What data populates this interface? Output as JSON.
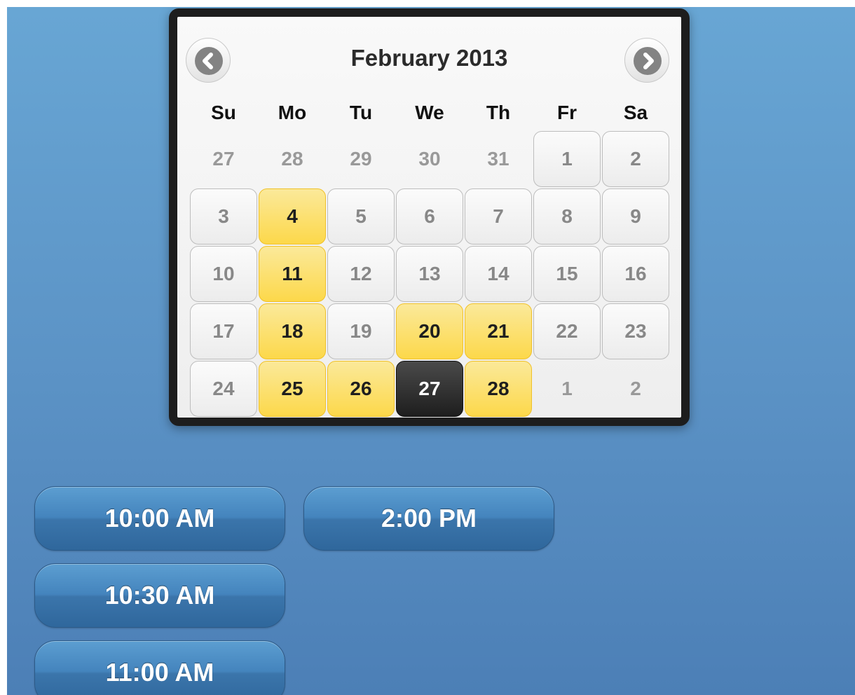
{
  "calendar": {
    "title": "February 2013",
    "prev_icon": "chevron-left-icon",
    "next_icon": "chevron-right-icon",
    "weekdays": [
      "Su",
      "Mo",
      "Tu",
      "We",
      "Th",
      "Fr",
      "Sa"
    ],
    "days": [
      {
        "label": "27",
        "kind": "other"
      },
      {
        "label": "28",
        "kind": "other"
      },
      {
        "label": "29",
        "kind": "other"
      },
      {
        "label": "30",
        "kind": "other"
      },
      {
        "label": "31",
        "kind": "other"
      },
      {
        "label": "1",
        "kind": "cur"
      },
      {
        "label": "2",
        "kind": "cur"
      },
      {
        "label": "3",
        "kind": "cur"
      },
      {
        "label": "4",
        "kind": "avail"
      },
      {
        "label": "5",
        "kind": "cur"
      },
      {
        "label": "6",
        "kind": "cur"
      },
      {
        "label": "7",
        "kind": "cur"
      },
      {
        "label": "8",
        "kind": "cur"
      },
      {
        "label": "9",
        "kind": "cur"
      },
      {
        "label": "10",
        "kind": "cur"
      },
      {
        "label": "11",
        "kind": "avail"
      },
      {
        "label": "12",
        "kind": "cur"
      },
      {
        "label": "13",
        "kind": "cur"
      },
      {
        "label": "14",
        "kind": "cur"
      },
      {
        "label": "15",
        "kind": "cur"
      },
      {
        "label": "16",
        "kind": "cur"
      },
      {
        "label": "17",
        "kind": "cur"
      },
      {
        "label": "18",
        "kind": "avail"
      },
      {
        "label": "19",
        "kind": "cur"
      },
      {
        "label": "20",
        "kind": "avail"
      },
      {
        "label": "21",
        "kind": "avail"
      },
      {
        "label": "22",
        "kind": "cur"
      },
      {
        "label": "23",
        "kind": "cur"
      },
      {
        "label": "24",
        "kind": "cur"
      },
      {
        "label": "25",
        "kind": "avail"
      },
      {
        "label": "26",
        "kind": "avail"
      },
      {
        "label": "27",
        "kind": "sel"
      },
      {
        "label": "28",
        "kind": "avail"
      },
      {
        "label": "1",
        "kind": "other"
      },
      {
        "label": "2",
        "kind": "other"
      }
    ]
  },
  "time_slots": [
    {
      "label": "10:00 AM"
    },
    {
      "label": "2:00 PM"
    },
    {
      "label": "10:30 AM"
    },
    {
      "label": "11:00 AM"
    }
  ],
  "colors": {
    "background_top": "#68a6d4",
    "background_bottom": "#4c7fb6",
    "available_day": "#fcd84a",
    "selected_day": "#2b2b2b",
    "slot_button": "#4484bd"
  }
}
